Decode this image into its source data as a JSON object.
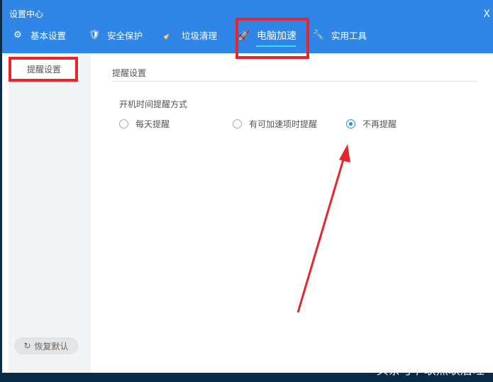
{
  "window": {
    "title": "设置中心",
    "close": "X"
  },
  "tabs": [
    {
      "label": "基本设置",
      "icon": "⚙"
    },
    {
      "label": "安全保护",
      "icon": "🛡"
    },
    {
      "label": "垃圾清理",
      "icon": "🧹"
    },
    {
      "label": "电脑加速",
      "icon": "🚀"
    },
    {
      "label": "实用工具",
      "icon": "🔧"
    }
  ],
  "sidebar": {
    "items": [
      {
        "label": "提醒设置"
      }
    ],
    "restore_label": "恢复默认",
    "restore_icon": "↻"
  },
  "main": {
    "section_title": "提醒设置",
    "option_label": "开机时间提醒方式",
    "options": [
      {
        "label": "每天提醒",
        "selected": false
      },
      {
        "label": "有可加速项时提醒",
        "selected": false
      },
      {
        "label": "不再提醒",
        "selected": true
      }
    ]
  },
  "watermark": "头条号 / 耿然耿后旺",
  "colors": {
    "accent": "#2f86e6",
    "annotation": "#e8252a"
  }
}
